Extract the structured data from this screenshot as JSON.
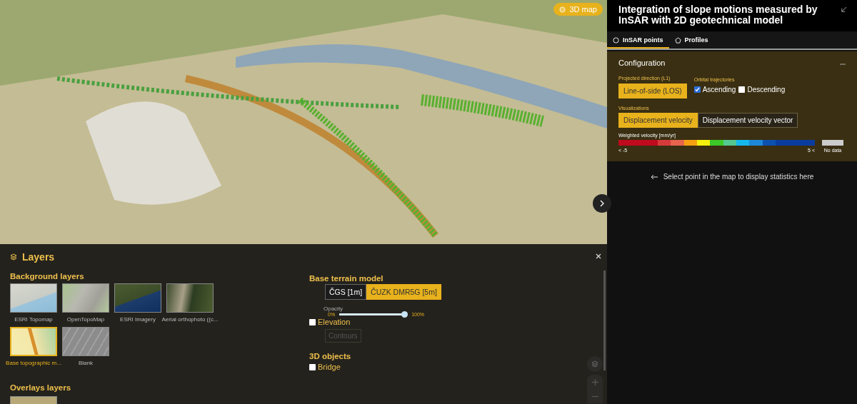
{
  "map": {
    "badge": "3D map"
  },
  "layers_panel": {
    "title": "Layers",
    "background_layers": {
      "heading": "Background layers",
      "items": [
        {
          "label": "ESRI Topomap",
          "kind": "topo",
          "selected": false
        },
        {
          "label": "OpenTopoMap",
          "kind": "opentopo",
          "selected": false
        },
        {
          "label": "ESRI Imagery",
          "kind": "imagery",
          "selected": false
        },
        {
          "label": "Aerial orthophoto ((c...",
          "kind": "aerial",
          "selected": false
        },
        {
          "label": "Base topographic m...",
          "kind": "base",
          "selected": true
        },
        {
          "label": "Blank",
          "kind": "blank",
          "selected": false
        }
      ]
    },
    "overlays_heading": "Overlays layers",
    "terrain": {
      "heading": "Base terrain model",
      "options": [
        {
          "label": "ČGS [1m]",
          "selected": false
        },
        {
          "label": "ČUZK DMR5G [5m]",
          "selected": true
        }
      ],
      "opacity_label": "Opacity",
      "min": "0%",
      "max": "100%",
      "level": 0.97
    },
    "elevation": {
      "label": "Elevation",
      "checked": false
    },
    "contours": {
      "label": "Contours",
      "disabled": true
    },
    "objects_heading": "3D objects",
    "bridge": {
      "label": "Bridge",
      "checked": false
    }
  },
  "sidebar": {
    "title": "Integration of slope motions measured by InSAR with 2D geotechnical model",
    "tabs": [
      {
        "label": "InSAR points",
        "kind": "circle",
        "selected": true
      },
      {
        "label": "Profiles",
        "kind": "pentagon",
        "selected": false
      }
    ],
    "configuration": {
      "heading": "Configuration",
      "expanded": true,
      "projected_direction": {
        "label": "Projected direction (L1)",
        "options": [
          {
            "label": "Line-of-side (LOS)",
            "selected": true
          }
        ]
      },
      "orbital_trajectories": {
        "label": "Orbital trajectories",
        "options": [
          {
            "label": "Ascending",
            "checked": true
          },
          {
            "label": "Descending",
            "checked": false
          }
        ]
      },
      "visualizations": {
        "label": "Visualizations",
        "options": [
          {
            "label": "Displacement velocity",
            "selected": true
          },
          {
            "label": "Displacement velocity vector",
            "selected": false
          }
        ]
      },
      "legend": {
        "label": "Weighted velocity [mm/yr]",
        "colors": [
          {
            "color": "#c00a1e"
          },
          {
            "color": "#c00a1e"
          },
          {
            "color": "#c00a1e"
          },
          {
            "color": "#d63a3a"
          },
          {
            "color": "#e8644e"
          },
          {
            "color": "#f5a010"
          },
          {
            "color": "#f5f00c"
          },
          {
            "color": "#3cc828"
          },
          {
            "color": "#54c890"
          },
          {
            "color": "#14b8ec"
          },
          {
            "color": "#1e88d8"
          },
          {
            "color": "#0c50b0"
          },
          {
            "color": "#0a3ca0"
          },
          {
            "color": "#0a3ca0"
          },
          {
            "color": "#0a3ca0"
          }
        ],
        "min": "< -5",
        "max": "5 <",
        "no_data": "No data"
      }
    },
    "hint": "Select point in the map to display statistics here"
  }
}
